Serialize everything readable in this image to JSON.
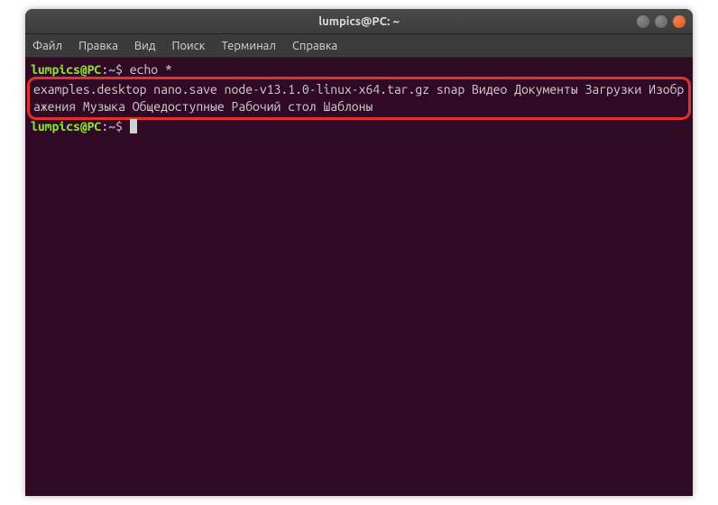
{
  "window": {
    "title": "lumpics@PC: ~"
  },
  "menubar": {
    "items": [
      {
        "label": "Файл"
      },
      {
        "label": "Правка"
      },
      {
        "label": "Вид"
      },
      {
        "label": "Поиск"
      },
      {
        "label": "Терминал"
      },
      {
        "label": "Справка"
      }
    ]
  },
  "terminal": {
    "prompt_user": "lumpics@PC",
    "prompt_colon": ":",
    "prompt_path": "~",
    "prompt_dollar": "$",
    "lines": [
      {
        "command": " echo *"
      },
      {
        "output": "examples.desktop nano.save node-v13.1.0-linux-x64.tar.gz snap Видео Документы Загрузки Изображения Музыка Общедоступные Рабочий стол Шаблоны"
      },
      {
        "command": " "
      }
    ]
  }
}
